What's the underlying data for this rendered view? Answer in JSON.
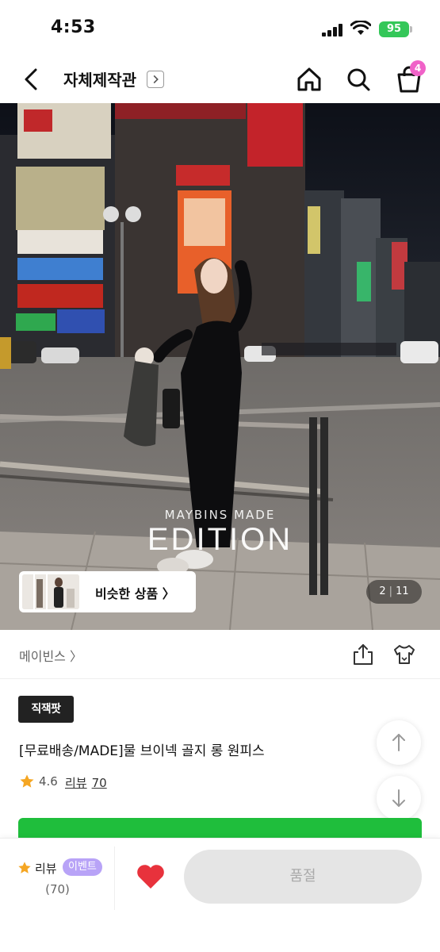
{
  "status_bar": {
    "time": "4:53",
    "battery": "95"
  },
  "nav": {
    "title": "자체제작관",
    "cart_count": "4"
  },
  "hero": {
    "watermark_sub": "MAYBINS MADE",
    "watermark_main": "EDITION",
    "similar_label": "비슷한 상품 〉",
    "page_current": "2",
    "page_total": "11"
  },
  "brand": {
    "name": "메이빈스 〉"
  },
  "product": {
    "badge": "직잭팟",
    "title": "[무료배송/MADE]물 브이넥 골지 롱 원피스",
    "rating": "4.6",
    "review_label": "리뷰",
    "review_count": "70"
  },
  "bottom_bar": {
    "review_label": "리뷰",
    "event_label": "이벤트",
    "review_count": "(70)",
    "sold_out_label": "품절"
  },
  "colors": {
    "cart_badge": "#f062c8",
    "battery": "#34c759",
    "event_pill": "#b8a3f7",
    "green_banner": "#1fbe3c",
    "like": "#e8323c",
    "star": "#f5a623"
  }
}
